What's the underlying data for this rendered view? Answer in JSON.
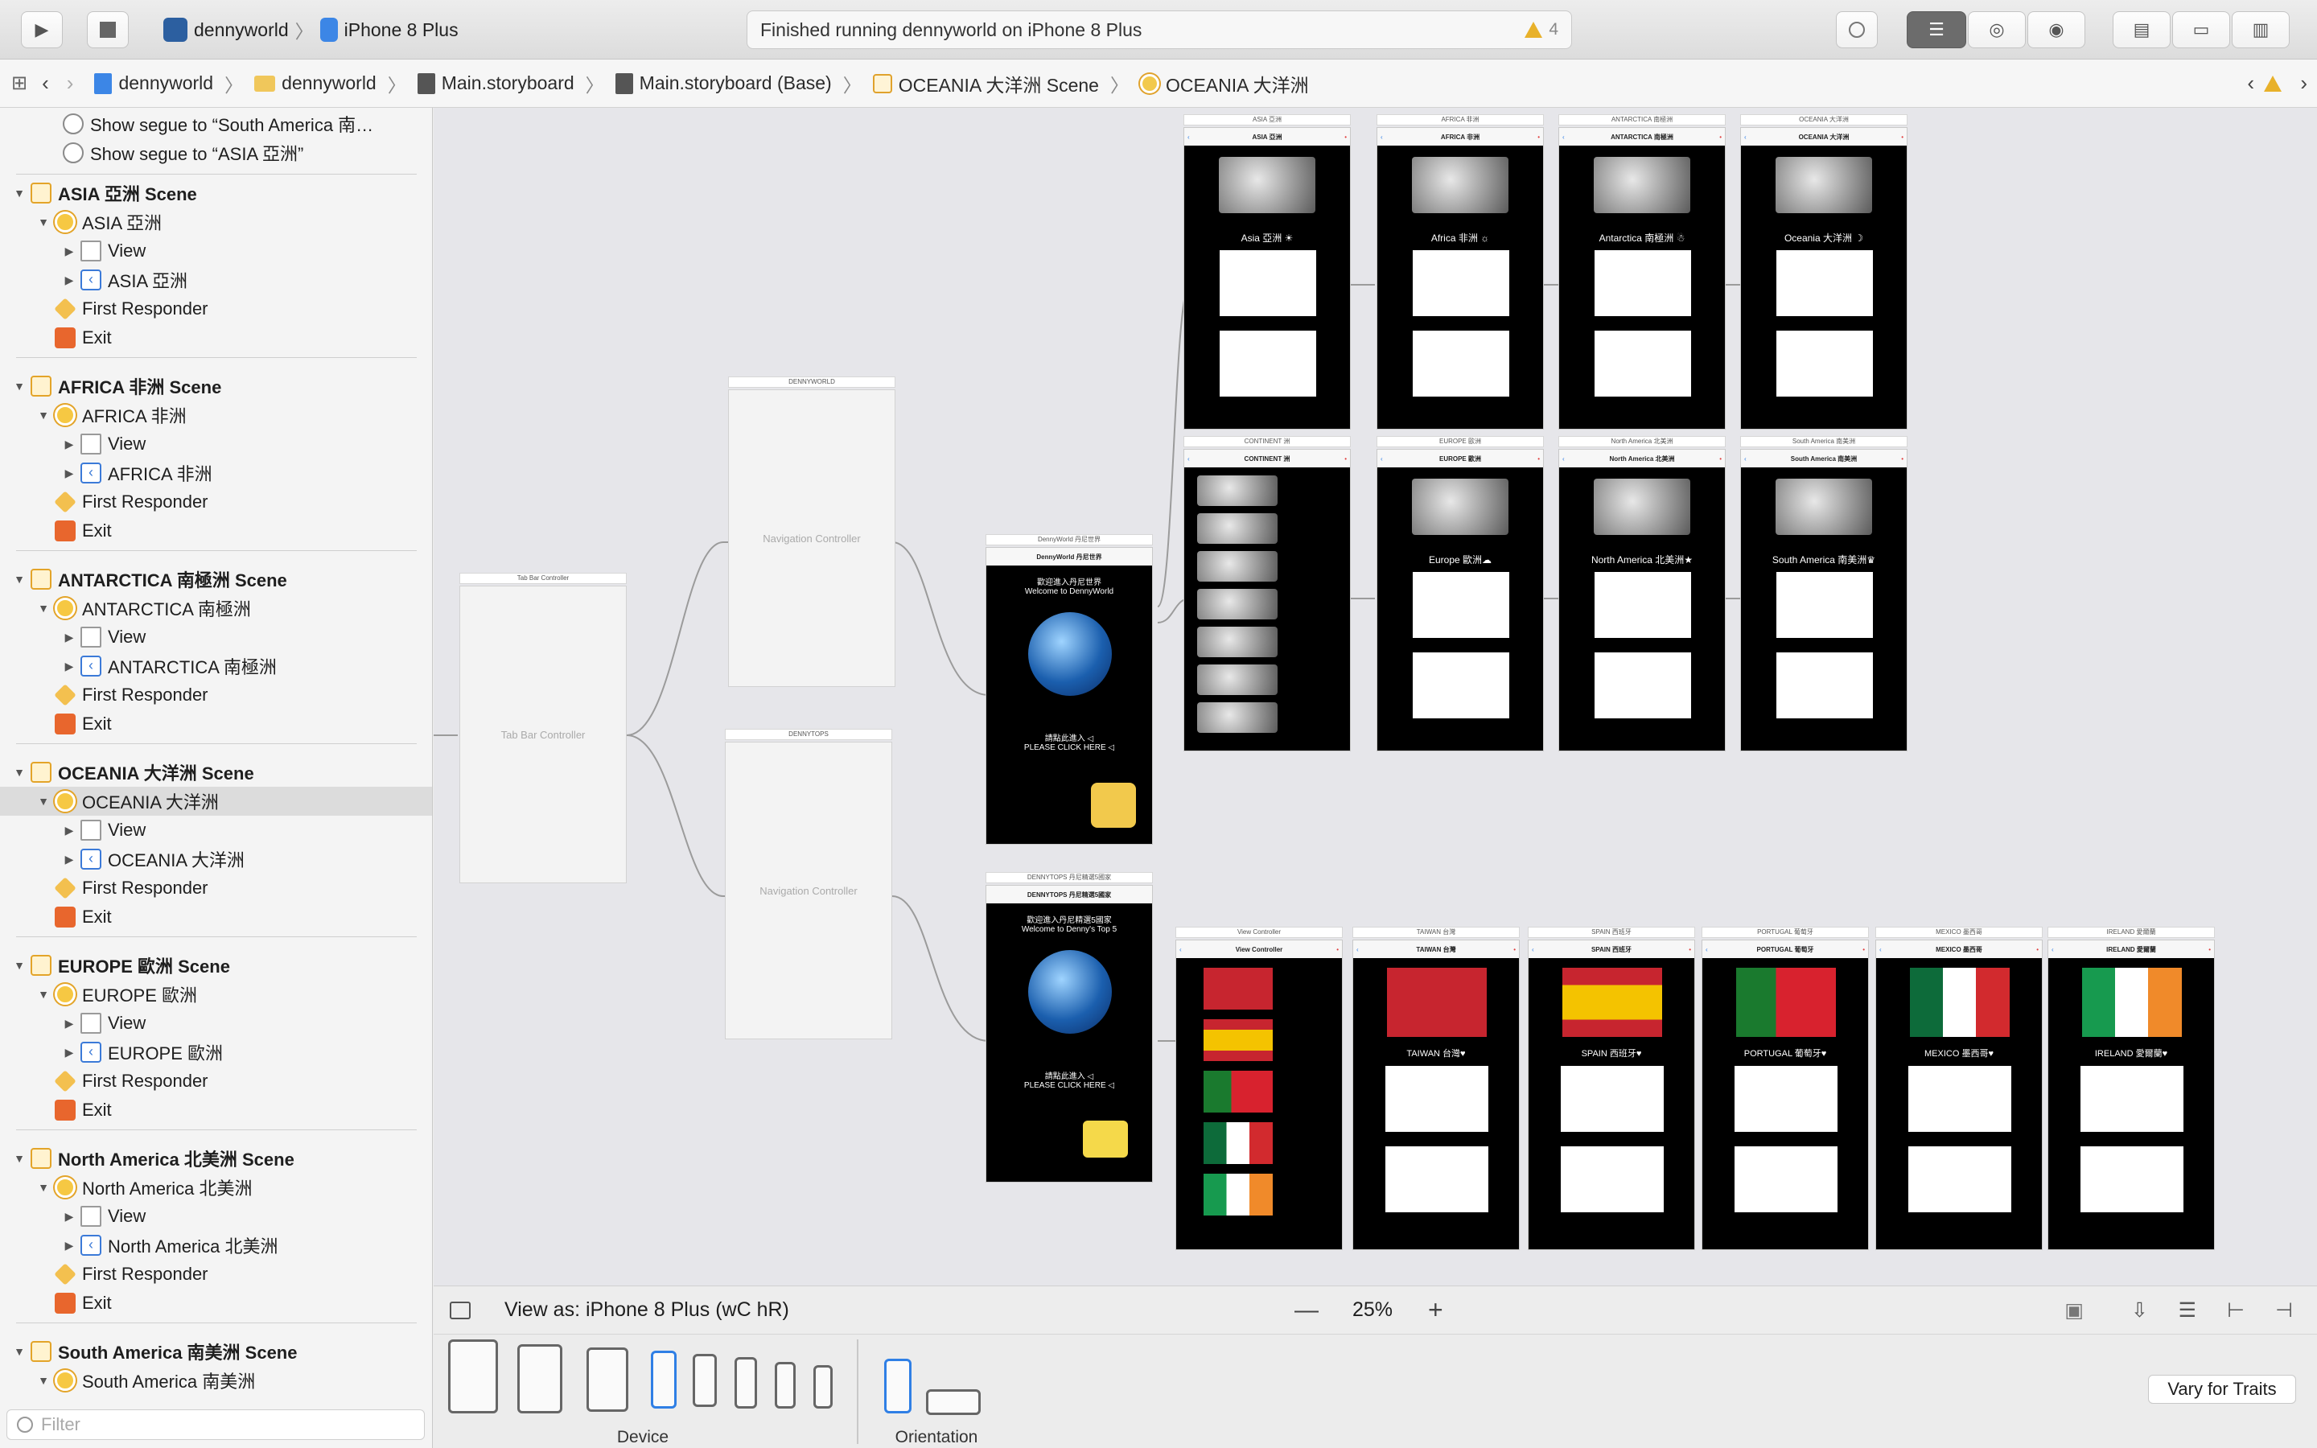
{
  "toolbar": {
    "scheme_project": "dennyworld",
    "scheme_device": "iPhone 8 Plus",
    "status": "Finished running dennyworld on iPhone 8 Plus",
    "warning_count": "4"
  },
  "jumpbar": {
    "crumbs": [
      "dennyworld",
      "dennyworld",
      "Main.storyboard",
      "Main.storyboard (Base)",
      "OCEANIA 大洋洲 Scene",
      "OCEANIA 大洋洲"
    ]
  },
  "outline": {
    "segue1": "Show segue to “South America 南…",
    "segue2": "Show segue to “ASIA 亞洲”",
    "asia_scene": "ASIA 亞洲 Scene",
    "asia_vc": "ASIA 亞洲",
    "asia_view": "View",
    "asia_nav": "ASIA 亞洲",
    "asia_fr": "First Responder",
    "asia_exit": "Exit",
    "africa_scene": "AFRICA 非洲 Scene",
    "africa_vc": "AFRICA 非洲",
    "africa_view": "View",
    "africa_nav": "AFRICA 非洲",
    "africa_fr": "First Responder",
    "africa_exit": "Exit",
    "ant_scene": "ANTARCTICA 南極洲 Scene",
    "ant_vc": "ANTARCTICA 南極洲",
    "ant_view": "View",
    "ant_nav": "ANTARCTICA 南極洲",
    "ant_fr": "First Responder",
    "ant_exit": "Exit",
    "oce_scene": "OCEANIA 大洋洲 Scene",
    "oce_vc": "OCEANIA 大洋洲",
    "oce_view": "View",
    "oce_nav": "OCEANIA 大洋洲",
    "oce_fr": "First Responder",
    "oce_exit": "Exit",
    "eu_scene": "EUROPE 歐洲 Scene",
    "eu_vc": "EUROPE 歐洲",
    "eu_view": "View",
    "eu_nav": "EUROPE 歐洲",
    "eu_fr": "First Responder",
    "eu_exit": "Exit",
    "na_scene": "North America 北美洲 Scene",
    "na_vc": "North America 北美洲",
    "na_view": "View",
    "na_nav": "North America 北美洲",
    "na_fr": "First Responder",
    "na_exit": "Exit",
    "sa_scene": "South America 南美洲 Scene",
    "sa_vc": "South America 南美洲"
  },
  "filter_placeholder": "Filter",
  "canvas": {
    "tabbar_title": "Tab Bar Controller",
    "tabbar_label": "Tab Bar Controller",
    "nav1_title": "DENNYWORLD",
    "nav1_label": "Navigation Controller",
    "nav2_title": "DENNYTOPS",
    "nav2_label": "Navigation Controller",
    "dw_title": "DennyWorld 丹尼世界",
    "dw_head": "DennyWorld 丹尼世界",
    "dw_welcome": "歡迎進入丹尼世界\nWelcome to DennyWorld",
    "dw_click": "請點此進入 ◁\nPLEASE CLICK HERE ◁",
    "dt_title": "DENNYTOPS 丹尼精選5國家",
    "dt_head": "DENNYTOPS 丹尼精選5國家",
    "dt_welcome": "歡迎進入丹尼精選5國家\nWelcome to Denny's Top 5",
    "dt_click": "請點此進入 ◁\nPLEASE CLICK HERE ◁",
    "continents": [
      {
        "title": "ASIA 亞洲",
        "caption": "Asia 亞洲 ☀"
      },
      {
        "title": "AFRICA 非洲",
        "caption": "Africa 非洲 ☼"
      },
      {
        "title": "ANTARCTICA 南極洲",
        "caption": "Antarctica 南極洲 ☃"
      },
      {
        "title": "OCEANIA 大洋洲",
        "caption": "Oceania 大洋洲 ☽"
      },
      {
        "title": "CONTINENT 洲",
        "caption": ""
      },
      {
        "title": "EUROPE 歐洲",
        "caption": "Europe 歐洲☁"
      },
      {
        "title": "North America 北美洲",
        "caption": "North America 北美洲★"
      },
      {
        "title": "South America 南美洲",
        "caption": "South America 南美洲♛"
      }
    ],
    "countries": [
      {
        "title": "View Controller",
        "caption": ""
      },
      {
        "title": "TAIWAN 台灣",
        "caption": "TAIWAN 台灣♥"
      },
      {
        "title": "SPAIN 西班牙",
        "caption": "SPAIN 西班牙♥"
      },
      {
        "title": "PORTUGAL 葡萄牙",
        "caption": "PORTUGAL 葡萄牙♥"
      },
      {
        "title": "MEXICO 墨西哥",
        "caption": "MEXICO 墨西哥♥"
      },
      {
        "title": "IRELAND 愛爾蘭",
        "caption": "IRELAND 愛爾蘭♥"
      }
    ]
  },
  "bottom": {
    "view_as": "View as: iPhone 8 Plus (wC hR)",
    "zoom": "25%",
    "device_label": "Device",
    "orientation_label": "Orientation",
    "vary": "Vary for Traits"
  },
  "colors": {
    "accent": "#2f7fe5",
    "warning": "#e8b12a",
    "scene_icon": "#e3a429",
    "exit_icon": "#e8662d"
  }
}
